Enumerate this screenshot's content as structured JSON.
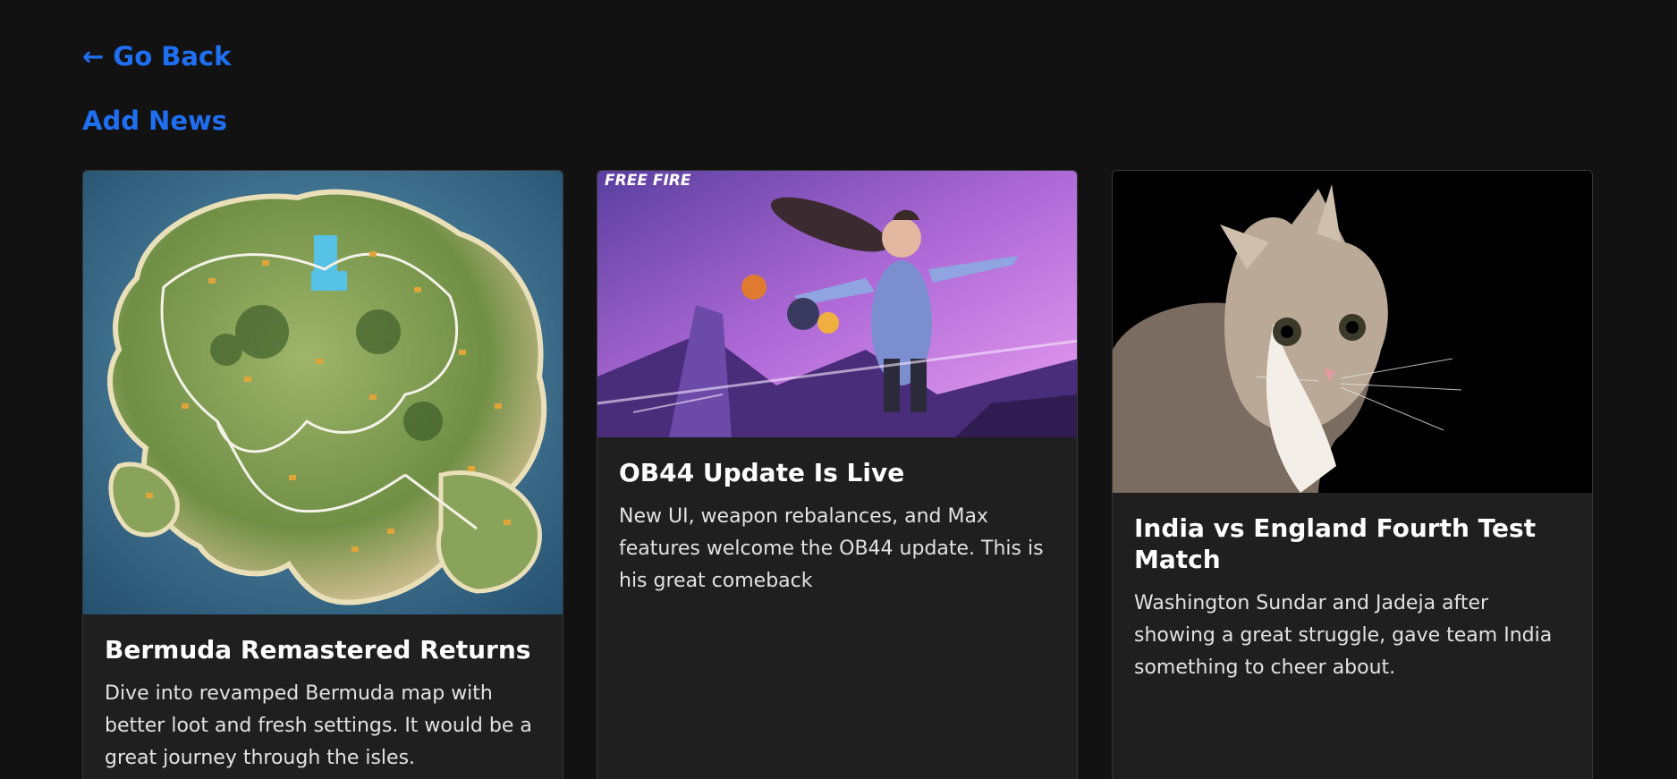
{
  "nav": {
    "go_back": "← Go Back",
    "add_news": "Add News"
  },
  "colors": {
    "background": "#121212",
    "card": "#1f1f1f",
    "link": "#1f6ff2",
    "title": "#ffffff",
    "text": "#e2e2e2"
  },
  "cards": [
    {
      "image": "bermuda-map-image",
      "title": "Bermuda Remastered Returns",
      "text": "Dive into revamped Bermuda map with better loot and fresh settings. It would be a great journey through the isles."
    },
    {
      "image": "free-fire-ob44-image",
      "logo_text": "FREE FIRE",
      "title": "OB44 Update Is Live",
      "text": "New UI, weapon rebalances, and Max features welcome the OB44 update. This is his great comeback"
    },
    {
      "image": "cat-image",
      "title": "India vs England Fourth Test Match",
      "text": "Washington Sundar and Jadeja after showing a great struggle, gave team India something to cheer about."
    }
  ]
}
